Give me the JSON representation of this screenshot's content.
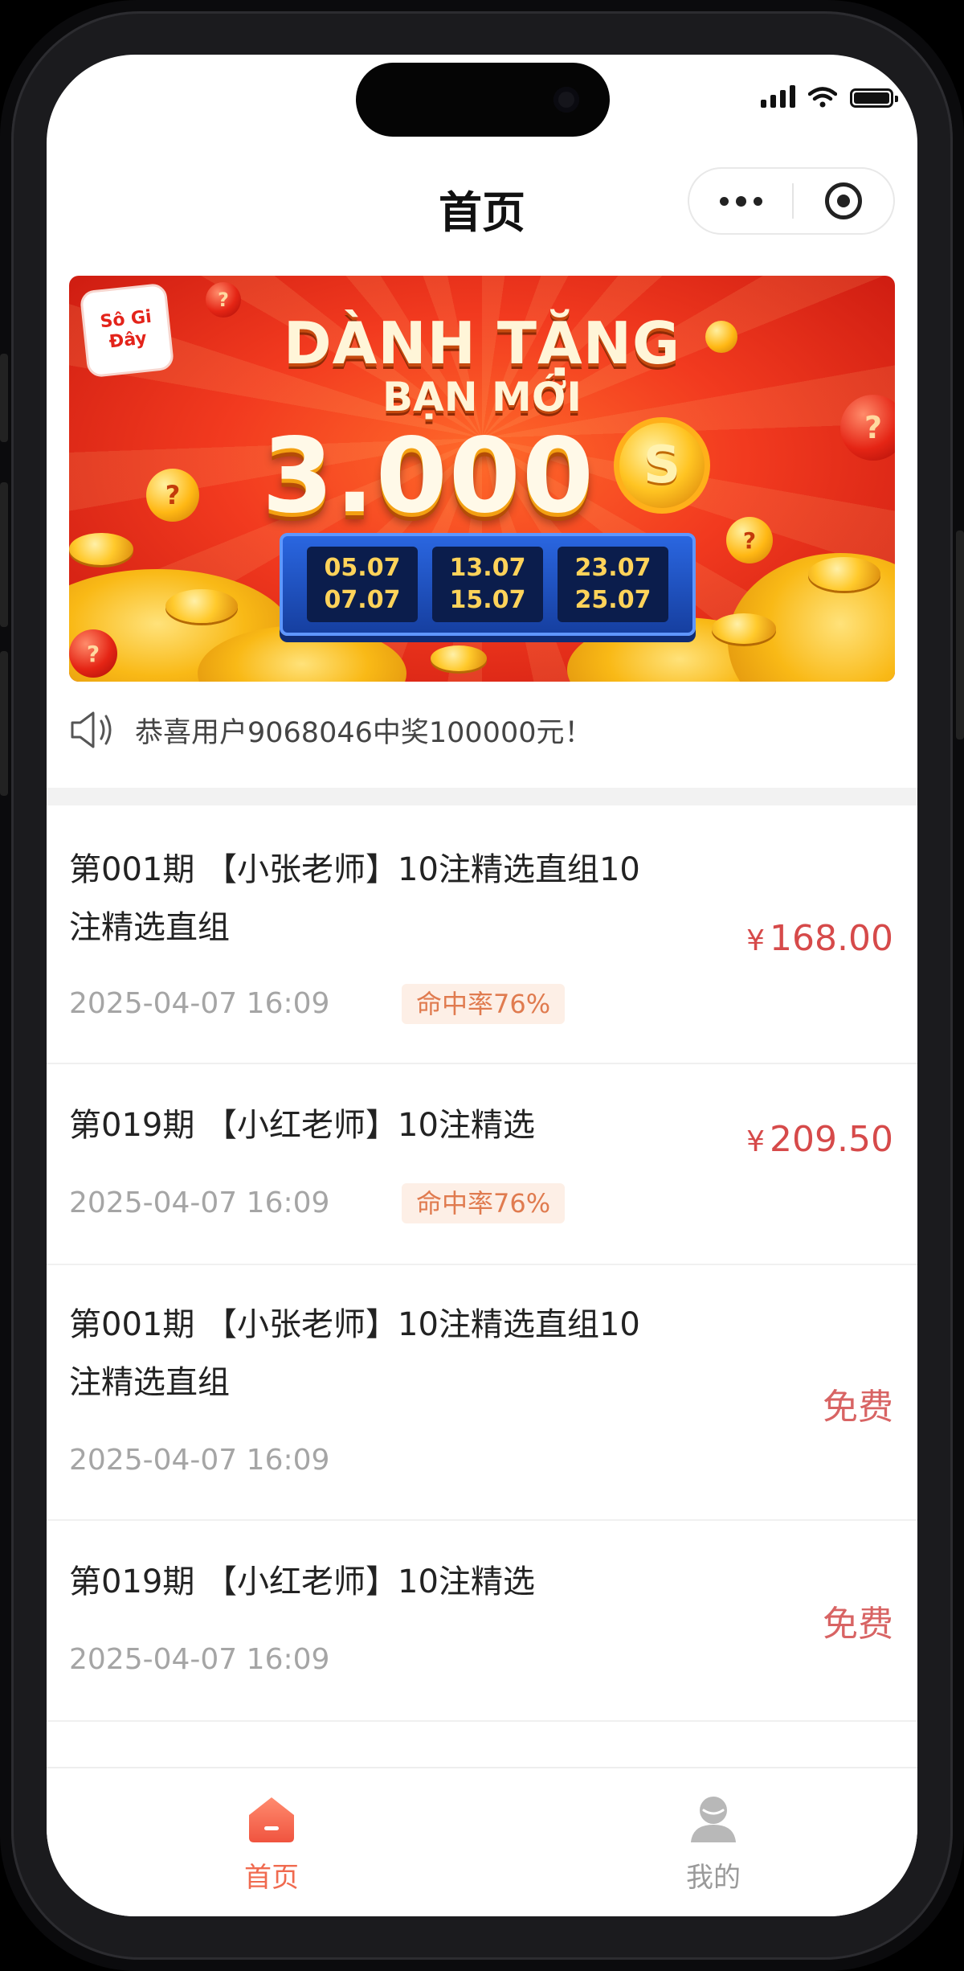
{
  "theme": {
    "accent": "#d64a4a",
    "price": "#d64a4a",
    "free": "#d86464",
    "badge_bg": "#fdefe6",
    "badge_text": "#e07b4f",
    "tab_active": "#f06a4f",
    "tab_inactive": "#9a9a9a"
  },
  "navbar": {
    "title": "首页",
    "more_icon": "more-dots-icon",
    "close_icon": "target-close-icon"
  },
  "banner": {
    "logo_line1": "Sô Gi",
    "logo_line2": "Đây",
    "headline": "DÀNH TẶNG",
    "subheadline": "BẠN MỚI",
    "amount": "3.000",
    "coin_symbol": "S",
    "date_ranges": [
      {
        "start": "05.07",
        "end": "07.07"
      },
      {
        "start": "13.07",
        "end": "15.07"
      },
      {
        "start": "23.07",
        "end": "25.07"
      }
    ],
    "ball_symbol": "?"
  },
  "announcement": {
    "icon": "speaker-icon",
    "text": "恭喜用户9068046中奖100000元！"
  },
  "items": [
    {
      "title": "第001期 【小张老师】10注精选直组10注精选直组",
      "date": "2025-04-07 16:09",
      "badge": "命中率76%",
      "price_symbol": "¥",
      "price": "168.00"
    },
    {
      "title": "第019期 【小红老师】10注精选",
      "date": "2025-04-07 16:09",
      "badge": "命中率76%",
      "price_symbol": "¥",
      "price": "209.50"
    },
    {
      "title": "第001期 【小张老师】10注精选直组10注精选直组",
      "date": "2025-04-07 16:09",
      "free": "免费"
    },
    {
      "title": "第019期 【小红老师】10注精选",
      "date": "2025-04-07 16:09",
      "free": "免费"
    }
  ],
  "tabbar": {
    "home": {
      "label": "首页",
      "icon": "home-icon"
    },
    "mine": {
      "label": "我的",
      "icon": "user-icon"
    }
  }
}
